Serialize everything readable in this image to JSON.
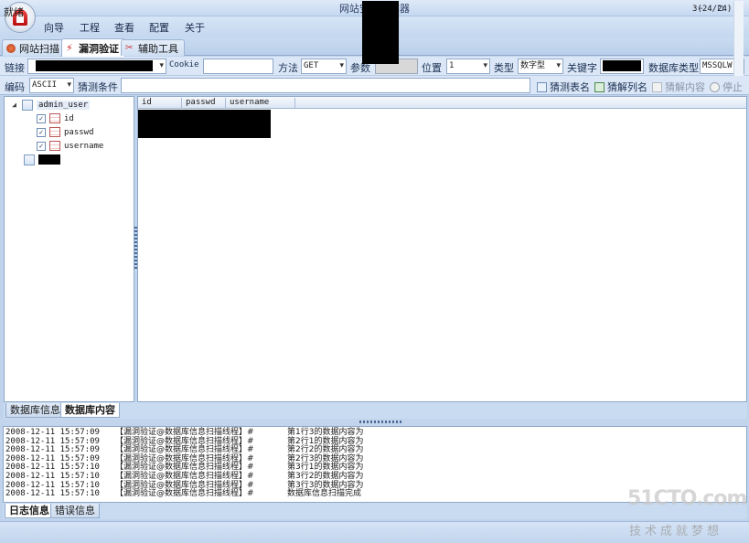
{
  "window": {
    "title": "网站安全扫描器",
    "controls": [
      "–",
      "▫",
      "✕"
    ]
  },
  "menu": [
    "向导",
    "工程",
    "查看",
    "配置",
    "关于"
  ],
  "tabs": [
    {
      "label": "网站扫描",
      "active": false,
      "icon": "globe-icon"
    },
    {
      "label": "漏洞验证",
      "active": true,
      "icon": "lightning-icon"
    },
    {
      "label": "辅助工具",
      "active": false,
      "icon": "tools-icon"
    }
  ],
  "params": {
    "link_label": "链接",
    "cookie_label": "Cookie",
    "cookie_value": "",
    "method_label": "方法",
    "method_value": "GET",
    "param_label": "参数",
    "param_value": "",
    "position_label": "位置",
    "position_value": "1",
    "type_label": "类型",
    "type_value": "数字型",
    "keyword_label": "关键字",
    "dbtype_label": "数据库类型",
    "dbtype_value": "MSSQLW"
  },
  "row2": {
    "encoding_label": "编码",
    "encoding_value": "ASCII",
    "guess_cond_label": "猜测条件",
    "guess_cond_value": "",
    "btn_guess_table": "猜测表名",
    "btn_guess_column": "猜解列名",
    "btn_guess_content": "猜解内容",
    "btn_stop": "停止"
  },
  "tree": {
    "table_name": "admin_user",
    "columns": [
      {
        "name": "id",
        "checked": true
      },
      {
        "name": "passwd",
        "checked": true
      },
      {
        "name": "username",
        "checked": true
      }
    ]
  },
  "grid": {
    "headers": [
      "id",
      "passwd",
      "username"
    ]
  },
  "lower_tabs": [
    {
      "label": "数据库信息",
      "active": false
    },
    {
      "label": "数据库内容",
      "active": true
    }
  ],
  "log": [
    {
      "ts": "2008-12-11 15:57:09",
      "thread": "【漏洞验证@数据库信息扫描线程】#",
      "msg": "第1行3的数据内容为"
    },
    {
      "ts": "2008-12-11 15:57:09",
      "thread": "【漏洞验证@数据库信息扫描线程】#",
      "msg": "第2行1的数据内容为"
    },
    {
      "ts": "2008-12-11 15:57:09",
      "thread": "【漏洞验证@数据库信息扫描线程】#",
      "msg": "第2行2的数据内容为"
    },
    {
      "ts": "2008-12-11 15:57:09",
      "thread": "【漏洞验证@数据库信息扫描线程】#",
      "msg": "第2行3的数据内容为"
    },
    {
      "ts": "2008-12-11 15:57:10",
      "thread": "【漏洞验证@数据库信息扫描线程】#",
      "msg": "第3行1的数据内容为"
    },
    {
      "ts": "2008-12-11 15:57:10",
      "thread": "【漏洞验证@数据库信息扫描线程】#",
      "msg": "第3行2的数据内容为"
    },
    {
      "ts": "2008-12-11 15:57:10",
      "thread": "【漏洞验证@数据库信息扫描线程】#",
      "msg": "第3行3的数据内容为"
    },
    {
      "ts": "2008-12-11 15:57:10",
      "thread": "【漏洞验证@数据库信息扫描线程】#",
      "msg": "数据库信息扫描完成"
    }
  ],
  "log_tabs": [
    {
      "label": "日志信息",
      "active": true
    },
    {
      "label": "错误信息",
      "active": false
    }
  ],
  "status": {
    "text": "就绪",
    "count": "3(24/24)"
  },
  "watermark": {
    "main": "51CTO.com",
    "sub": "技术成就梦想"
  }
}
